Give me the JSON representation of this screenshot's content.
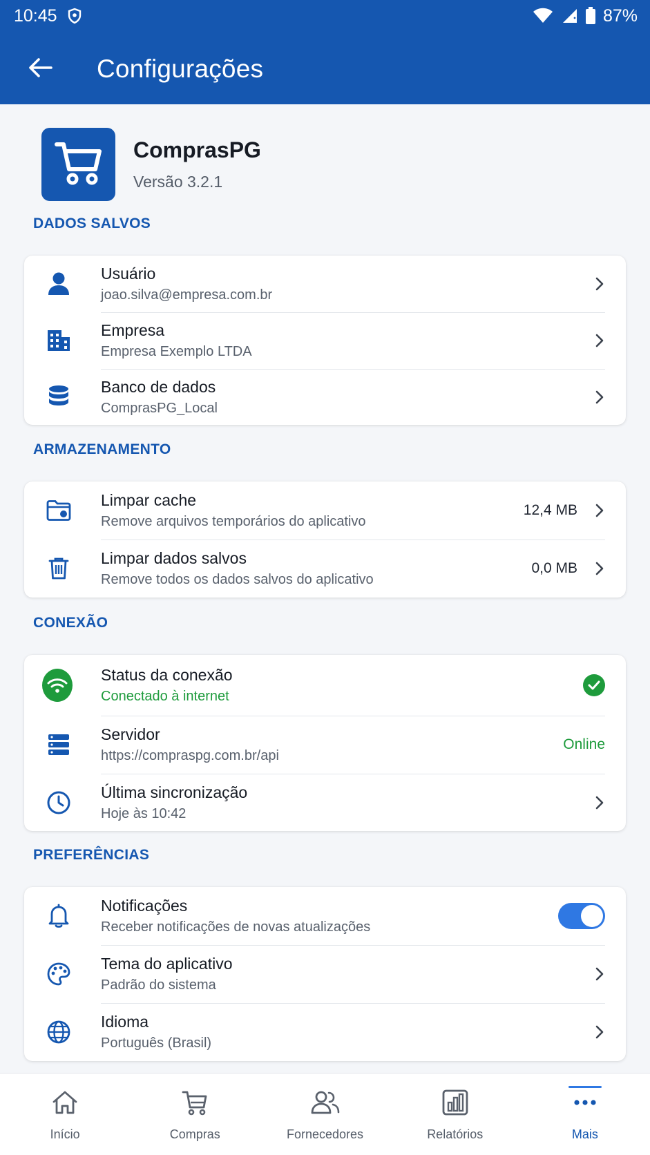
{
  "status_bar": {
    "time": "10:45",
    "battery": "87%"
  },
  "toolbar": {
    "title": "Configurações"
  },
  "app": {
    "name": "ComprasPG",
    "version": "Versão 3.2.1"
  },
  "sections": {
    "saved_data": {
      "title": "DADOS SALVOS",
      "items": [
        {
          "title": "Usuário",
          "subtitle": "joao.silva@empresa.com.br"
        },
        {
          "title": "Empresa",
          "subtitle": "Empresa Exemplo LTDA"
        },
        {
          "title": "Banco de dados",
          "subtitle": "ComprasPG_Local"
        }
      ]
    },
    "storage": {
      "title": "ARMAZENAMENTO",
      "items": [
        {
          "title": "Limpar cache",
          "subtitle": "Remove arquivos temporários do aplicativo",
          "value": "12,4 MB"
        },
        {
          "title": "Limpar dados salvos",
          "subtitle": "Remove todos os dados salvos do aplicativo",
          "value": "0,0 MB"
        }
      ]
    },
    "connection": {
      "title": "CONEXÃO",
      "items": [
        {
          "title": "Status da conexão",
          "subtitle": "Conectado à internet"
        },
        {
          "title": "Servidor",
          "subtitle": "https://compraspg.com.br/api",
          "value": "Online"
        },
        {
          "title": "Última sincronização",
          "subtitle": "Hoje às 10:42"
        }
      ]
    },
    "preferences": {
      "title": "PREFERÊNCIAS",
      "items": [
        {
          "title": "Notificações",
          "subtitle": "Receber notificações de novas atualizações",
          "enabled": true
        },
        {
          "title": "Tema do aplicativo",
          "subtitle": "Padrão do sistema"
        },
        {
          "title": "Idioma",
          "subtitle": "Português (Brasil)"
        }
      ]
    }
  },
  "bottom_nav": {
    "active": "Mais",
    "items": [
      {
        "label": "Início",
        "icon": "home-icon"
      },
      {
        "label": "Compras",
        "icon": "cart-icon"
      },
      {
        "label": "Fornecedores",
        "icon": "users-icon"
      },
      {
        "label": "Relatórios",
        "icon": "chart-icon"
      },
      {
        "label": "Mais",
        "icon": "more-icon"
      }
    ]
  },
  "colors": {
    "primary": "#1557b0",
    "accent": "#2f78e3",
    "success": "#1e9b3c",
    "background": "#f4f6f9"
  }
}
